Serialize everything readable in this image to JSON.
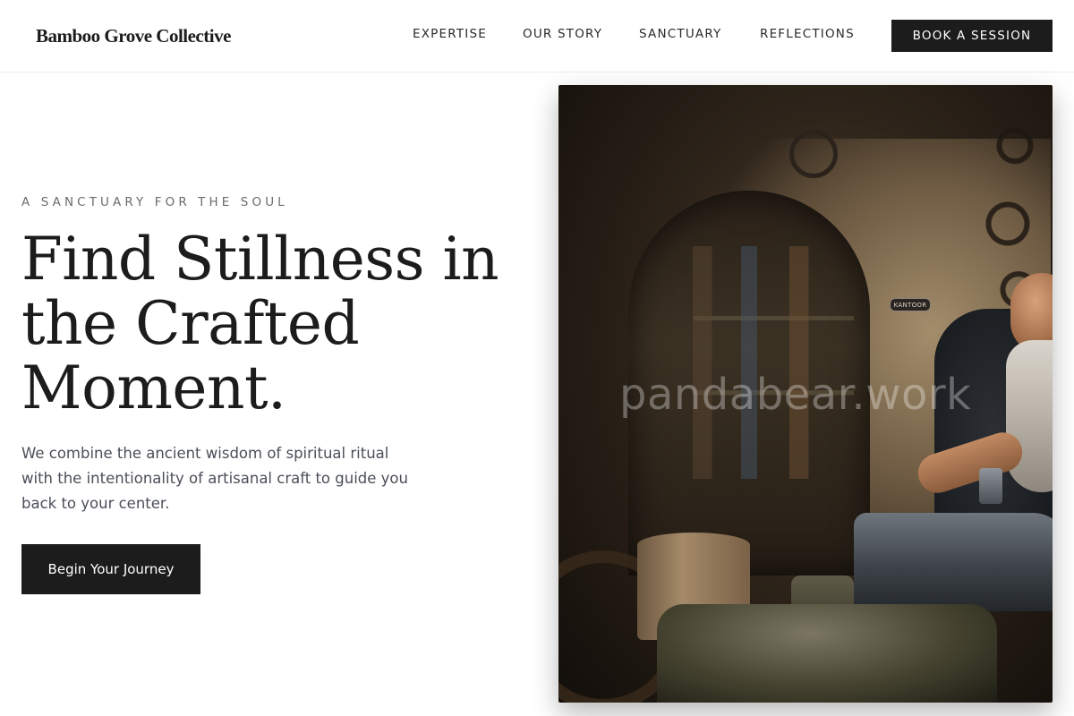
{
  "header": {
    "logo": "Bamboo Grove Collective",
    "nav": [
      "EXPERTISE",
      "OUR STORY",
      "SANCTUARY",
      "REFLECTIONS"
    ],
    "cta_label": "BOOK A SESSION"
  },
  "hero": {
    "eyebrow": "A SANCTUARY FOR THE SOUL",
    "headline_lines": [
      "Find Stillness in",
      "the Crafted",
      "Moment."
    ],
    "lede": "We combine the ancient wisdom of spiritual ritual with the intentionality of artisanal craft to guide you back to your center.",
    "cta_label": "Begin Your Journey",
    "image": {
      "sign_text": "KANTOOR",
      "watermark": "pandabear.work"
    }
  },
  "colors": {
    "accent": "#1c1c1c",
    "text_muted": "#6b6b6b",
    "body_text": "#4a4f57"
  }
}
